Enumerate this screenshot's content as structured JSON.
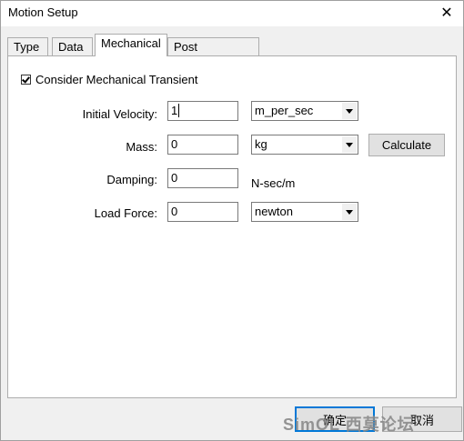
{
  "window": {
    "title": "Motion Setup",
    "close_glyph": "✕"
  },
  "tabs": [
    {
      "label": "Type"
    },
    {
      "label": "Data"
    },
    {
      "label": "Mechanical"
    },
    {
      "label": "Post Processing"
    }
  ],
  "active_tab": "Mechanical",
  "mechanical": {
    "consider_transient_label": "Consider Mechanical Transient",
    "consider_transient_checked": true,
    "initial_velocity": {
      "label": "Initial Velocity:",
      "value": "1",
      "unit": "m_per_sec"
    },
    "mass": {
      "label": "Mass:",
      "value": "0",
      "unit": "kg"
    },
    "damping": {
      "label": "Damping:",
      "value": "0",
      "unit": "N-sec/m"
    },
    "load_force": {
      "label": "Load Force:",
      "value": "0",
      "unit": "newton"
    },
    "calculate_label": "Calculate"
  },
  "footer": {
    "ok_label": "确定",
    "cancel_label": "取消"
  },
  "watermark": "SimOL 西莫论坛"
}
